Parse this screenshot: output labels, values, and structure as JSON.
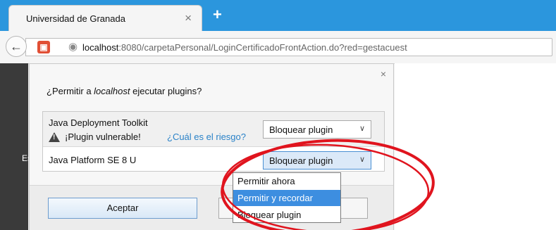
{
  "tab": {
    "title": "Universidad de Granada",
    "close": "×",
    "new_tab": "+"
  },
  "nav": {
    "back": "←",
    "url_host": "localhost",
    "url_rest": ":8080/carpetaPersonal/LoginCertificadoFrontAction.do?red=gestacuest"
  },
  "page": {
    "side_letters": "Es"
  },
  "panel": {
    "close": "×",
    "prompt_pre": "¿Permitir a ",
    "prompt_host": "localhost",
    "prompt_post": " ejecutar plugins?",
    "plugins": [
      {
        "name": "Java Deployment Toolkit",
        "warning": "¡Plugin vulnerable!",
        "risk_link": "¿Cuál es el riesgo?",
        "action": "Bloquear plugin"
      },
      {
        "name": "Java Platform SE 8 U",
        "action": "Bloquear plugin"
      }
    ],
    "dropdown_options": [
      "Permitir ahora",
      "Permitir y recordar",
      "Bloquear plugin"
    ],
    "accept": "Aceptar"
  },
  "colors": {
    "tab_strip": "#2b96dd",
    "annotation": "#e0141e",
    "selected_option": "#3d8ee0"
  }
}
